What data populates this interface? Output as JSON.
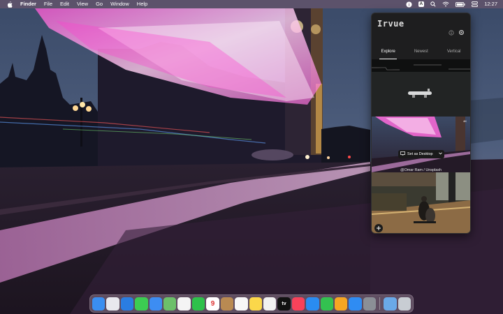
{
  "menubar": {
    "app_name": "Finder",
    "items": [
      "File",
      "Edit",
      "View",
      "Go",
      "Window",
      "Help"
    ],
    "input_source": "A",
    "clock": "12:27"
  },
  "popover": {
    "logo": "Irvue",
    "tabs": [
      {
        "label": "Explore",
        "active": true
      },
      {
        "label": "Newest",
        "active": false
      },
      {
        "label": "Vertical",
        "active": false
      }
    ],
    "set_desktop_label": "Set as Desktop",
    "credit": "@Omar Ram / Unsplash"
  },
  "dock": {
    "apps": [
      {
        "name": "finder-icon",
        "color": "#3a8ef0"
      },
      {
        "name": "launchpad-icon",
        "color": "#e8e8ee"
      },
      {
        "name": "safari-icon",
        "color": "#2a7de1"
      },
      {
        "name": "messages-icon",
        "color": "#3ccc52"
      },
      {
        "name": "mail-icon",
        "color": "#3d8df2"
      },
      {
        "name": "maps-icon",
        "color": "#6cc06a"
      },
      {
        "name": "photos-icon",
        "color": "#f4f4f4"
      },
      {
        "name": "facetime-icon",
        "color": "#2ec14b"
      },
      {
        "name": "calendar-icon",
        "color": "#ffffff",
        "text": "9"
      },
      {
        "name": "contacts-icon",
        "color": "#b98a52"
      },
      {
        "name": "reminders-icon",
        "color": "#f7f7f7"
      },
      {
        "name": "notes-icon",
        "color": "#fbd74a"
      },
      {
        "name": "freeform-icon",
        "color": "#f1f1f1"
      },
      {
        "name": "apple-tv-icon",
        "color": "#111111",
        "text": "tv"
      },
      {
        "name": "music-icon",
        "color": "#f7425a"
      },
      {
        "name": "keynote-icon",
        "color": "#2a8cf1"
      },
      {
        "name": "numbers-icon",
        "color": "#33c150"
      },
      {
        "name": "pages-icon",
        "color": "#f5a623"
      },
      {
        "name": "app-store-icon",
        "color": "#2f8cf3"
      },
      {
        "name": "system-settings-icon",
        "color": "#8b8f96"
      },
      {
        "name": "downloads-folder-icon",
        "color": "#6aa9e8"
      },
      {
        "name": "trash-icon",
        "color": "#c8cdd3"
      }
    ]
  }
}
